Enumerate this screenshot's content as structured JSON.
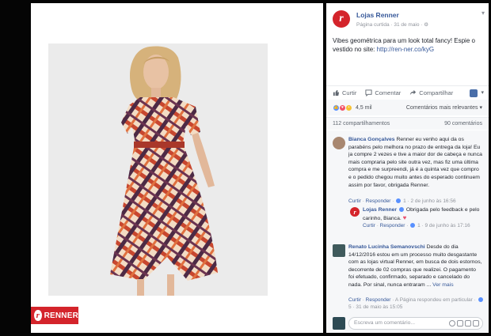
{
  "photo": {
    "brand_tag": {
      "text": "RENNER",
      "logo_letter": "r"
    }
  },
  "post": {
    "page_name": "Lojas Renner",
    "avatar_letter": "r",
    "meta": "Página curtida · 31 de maio · ",
    "text": "Vibes geométrica para um look total fancy! Espie o vestido no site: ",
    "link": "http://ren-ner.co/kyG"
  },
  "actions": {
    "like": "Curtir",
    "comment": "Comentar",
    "share": "Compartilhar"
  },
  "reactions": {
    "count": "4,5 mil",
    "filter": "Comentários mais relevantes"
  },
  "stats": {
    "shares": "112 compartilhamentos",
    "comments": "90 comentários"
  },
  "comments": [
    {
      "name": "Bianca Gonçalves",
      "text": "Renner eu venho aqui da os parabéns pelo melhora no prazo de entrega da loja! Eu ja compre 2 vezes e tive a maior dor de cabeça e nunca mais compraria pelo site outra vez, mas fiz uma última compra e me surpreendi, já é a quinta vez que compro e o pedido chegou muito antes do esperado continuem assim por favor, obrigada Renner.",
      "like": "Curtir",
      "reply": "Responder",
      "likes": "1",
      "time": "2 de junho às 16:56"
    },
    {
      "name": "Lojas Renner",
      "text": "Obrigada pelo feedback e pelo carinho, Bianca.",
      "like": "Curtir",
      "reply": "Responder",
      "likes": "1",
      "time": "9 de junho às 17:16"
    },
    {
      "name": "Renato Lucinha Semanovschi",
      "text": "Desde do dia 14/12/2016 estou em um processo muito desgastante com as lojas virtual Renner, em busca de dois estornos, decorrente de 02 compras que realizei. O pagamento foi efetuado, confirmado, separado e cancelado do nada. Por sinal, nunca entraram ...",
      "more": "Ver mais",
      "like": "Curtir",
      "reply": "Responder",
      "page_replied": "A Página respondeu em particular",
      "likes": "5",
      "time": "31 de maio às 15:05"
    }
  ],
  "comment_input": {
    "placeholder": "Escreva um comentário..."
  },
  "colors": {
    "brand_red": "#d4242b",
    "link_blue": "#365899",
    "page_bg": "#050505"
  }
}
